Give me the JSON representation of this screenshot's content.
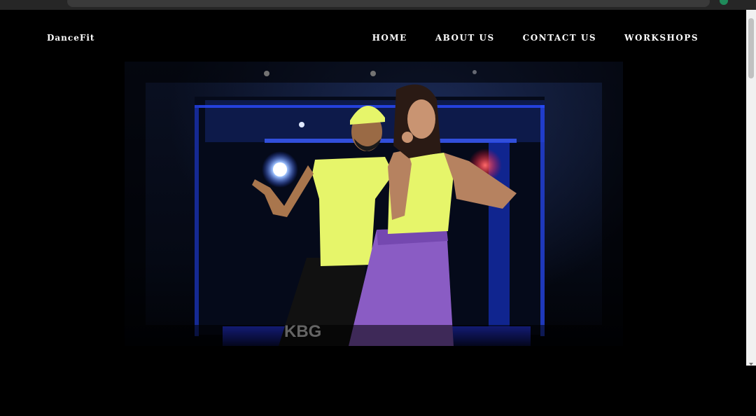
{
  "brand": {
    "name": "DanceFit"
  },
  "nav": {
    "items": [
      {
        "label": "HOME"
      },
      {
        "label": "ABOUT US"
      },
      {
        "label": "CONTACT US"
      },
      {
        "label": "WORKSHOPS"
      }
    ]
  },
  "hero": {
    "shirt_print": "KBG"
  },
  "colors": {
    "background": "#000000",
    "nav_text": "#ffffff",
    "neon_yellow": "#e6f56a",
    "purple": "#8a5cc4",
    "stage_blue": "#1e3cff"
  }
}
